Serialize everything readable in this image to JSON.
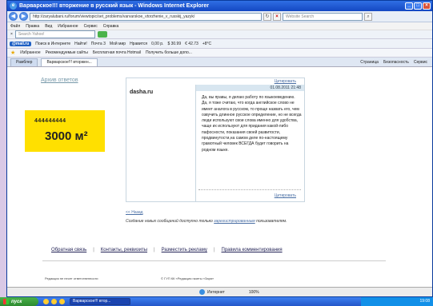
{
  "window": {
    "title": "Варварское!!! вторжение в русский язык - Windows Internet Explorer"
  },
  "address_bar": {
    "url": "http://zaryalubani.ru/forum/viewtopic/set_problems/varvarskoe_vtorzhenie_v_russkij_yazyk/",
    "search_placeholder": "Website Search"
  },
  "menu": {
    "items": [
      "Файл",
      "Правка",
      "Вид",
      "Избранное",
      "Сервис",
      "Справка"
    ]
  },
  "search_toolbar": {
    "placeholder": "Search Yahoo!"
  },
  "mail_toolbar": {
    "logo": "@mail.ru",
    "search": "Поиск в Интернете",
    "find": "Найти!",
    "mail": "Почта 3",
    "my_world": "Мой мир",
    "like": "Нравится",
    "money": "0,00 р.",
    "usd": "$ 30.99",
    "eur": "€ 42.73",
    "weather": "+8°C"
  },
  "favorites_bar": {
    "label": "Избранное",
    "items": [
      "Рекомендуемые сайты",
      "Бесплатная почта Hotmail",
      "Получить больше допо..."
    ]
  },
  "tabs": {
    "items": [
      "Рамблер",
      "Варварское!!! вторжен..."
    ],
    "tools": [
      "Страница",
      "Безопасность",
      "Сервис"
    ]
  },
  "page": {
    "top_link": "Архив ответов",
    "banner": {
      "number": "444444444",
      "amount": "3000 м²"
    },
    "post": {
      "quote_top": "Цитировать",
      "date": "01.08.2011 21:48",
      "author": "dasha.ru",
      "text": "Да, вы правы, я делаю работу по языкоеведению. Да, я тоже считаю, что когда английское слово не имеет аналога в русском, то проще назвать его, чем озвучить длинное русское определение, но не всегда люди используют свои слова именно для удобства, чаще их используют для придания какой-либо пафосности, показания своей развитости, продвинутости,на самом деле по-настоящему грамотный человек ВСЕГДА будет говорить на родном языке.",
      "quote_bottom": "Цитировать"
    },
    "back_link": "<< Назад",
    "notice_text": "Создание новых сообщений доступно только ",
    "notice_link": "зарегистрированным",
    "notice_tail": " пользователям.",
    "footer_links": [
      "Обратная связь",
      "Контакты, реквизиты",
      "Разместить рекламу",
      "Правила комментирования"
    ],
    "footer_left": "Редакция не несет ответственности",
    "footer_mid": "© ГУП КК «Редакция газеты «Заря»"
  },
  "status_bar": {
    "zone": "Интернет",
    "zoom": "100%"
  },
  "taskbar": {
    "start": "пуск",
    "task": "Варварское!!! втор...",
    "clock": "19:08"
  }
}
